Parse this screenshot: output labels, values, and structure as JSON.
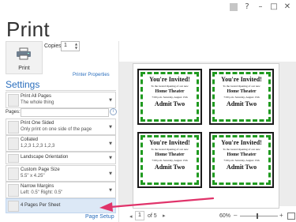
{
  "window": {
    "title": "Print"
  },
  "toolbar": {
    "print_label": "Print",
    "copies_label": "Copies:",
    "copies_value": "1",
    "printer_properties_label": "Printer Properties"
  },
  "settings": {
    "heading": "Settings",
    "pages_label": "Pages:",
    "options": [
      {
        "line1": "Print All Pages",
        "line2": "The whole thing"
      },
      {
        "line1": "Print One Sided",
        "line2": "Only print on one side of the page"
      },
      {
        "line1": "Collated",
        "line2": "1,2,3    1,2,3    1,2,3"
      },
      {
        "line1": "Landscape Orientation",
        "line2": ""
      },
      {
        "line1": "Custom Page Size",
        "line2": "5.5\" x 4.25\""
      },
      {
        "line1": "Narrow Margins",
        "line2": "Left:  0.5\"    Right:  0.5\""
      },
      {
        "line1": "4 Pages Per Sheet",
        "line2": ""
      }
    ],
    "page_setup_label": "Page Setup"
  },
  "preview": {
    "tickets": [
      {
        "title": "You're Invited!",
        "subtitle": "To the Grand Opening of our new",
        "name": "Home Theater",
        "date": "7:00 p.m. Saturday, August 15th",
        "admit": "Admit Two"
      },
      {
        "title": "You're Invited!",
        "subtitle": "To the Grand Opening of our new",
        "name": "Home Theater",
        "date": "7:00 p.m. Saturday, August 15th",
        "admit": "Admit Two"
      },
      {
        "title": "You're Invited!",
        "subtitle": "To the Grand Opening of our new",
        "name": "Home Theater",
        "date": "7:00 p.m. Saturday, August 15th",
        "admit": "Admit Two"
      },
      {
        "title": "You're Invited!",
        "subtitle": "To the Grand Opening of our new",
        "name": "Home Theater",
        "date": "7:00 p.m. Saturday, August 15th",
        "admit": "Admit Two"
      }
    ]
  },
  "navigation": {
    "page_value": "1",
    "of_text": "of 5",
    "zoom_label": "60%"
  },
  "colors": {
    "accent": "#2a6ebd",
    "selected_bg": "#dce8f6",
    "ticket_border": "#1f9a1f",
    "arrow": "#e0336a"
  }
}
